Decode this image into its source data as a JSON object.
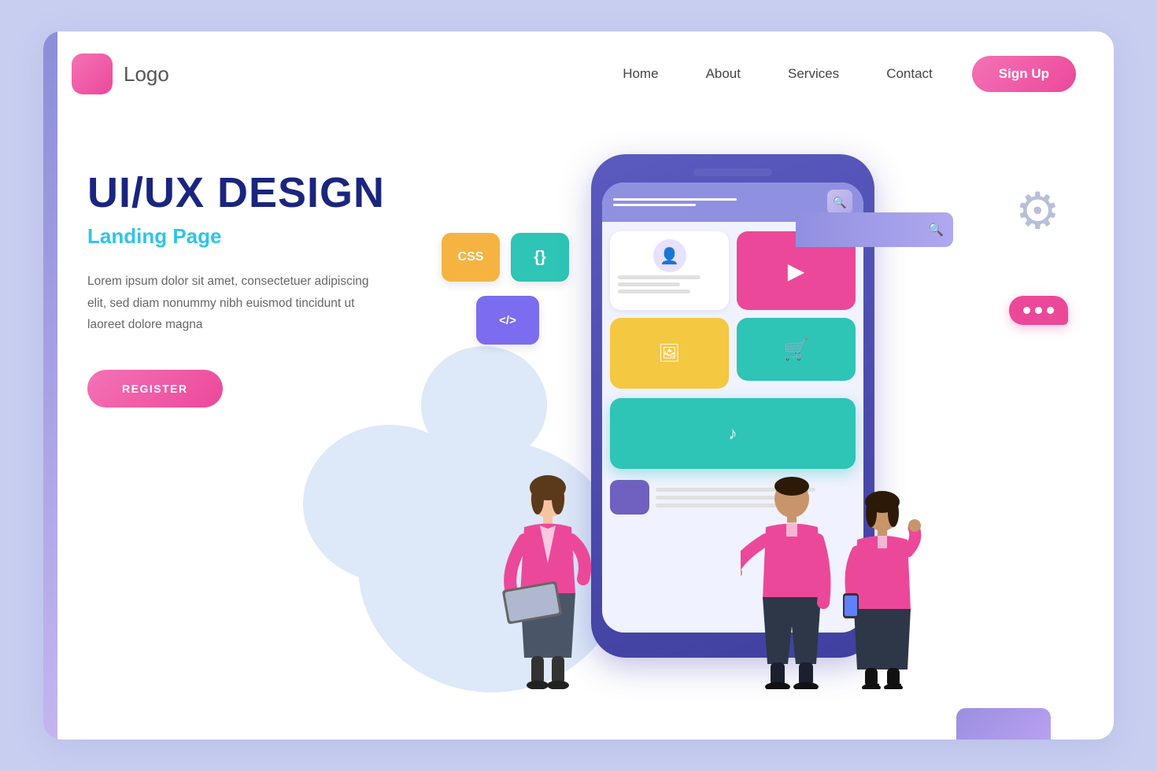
{
  "page": {
    "background_color": "#c8cef0",
    "card_bg": "#ffffff"
  },
  "navbar": {
    "logo_text": "Logo",
    "links": [
      {
        "label": "Home",
        "href": "#"
      },
      {
        "label": "About",
        "href": "#"
      },
      {
        "label": "Services",
        "href": "#"
      },
      {
        "label": "Contact",
        "href": "#"
      }
    ],
    "signup_label": "Sign Up"
  },
  "hero": {
    "title": "UI/UX DESIGN",
    "subtitle": "Landing Page",
    "description": "Lorem ipsum dolor sit amet, consectetuer adipiscing elit,\nsed diam nonummy nibh euismod tincidunt ut laoreet\ndolore magna",
    "register_label": "REGISTER"
  },
  "code_tags": [
    {
      "label": "CSS",
      "color": "#f5b342"
    },
    {
      "label": "{}",
      "color": "#2ec4b6"
    },
    {
      "label": "</>",
      "color": "#7b6cf0"
    }
  ],
  "icons": {
    "gear": "⚙",
    "search": "🔍",
    "user": "👤",
    "video_play": "▶",
    "cart": "🛒",
    "music": "♪",
    "image": "🖼",
    "chat": "..."
  }
}
